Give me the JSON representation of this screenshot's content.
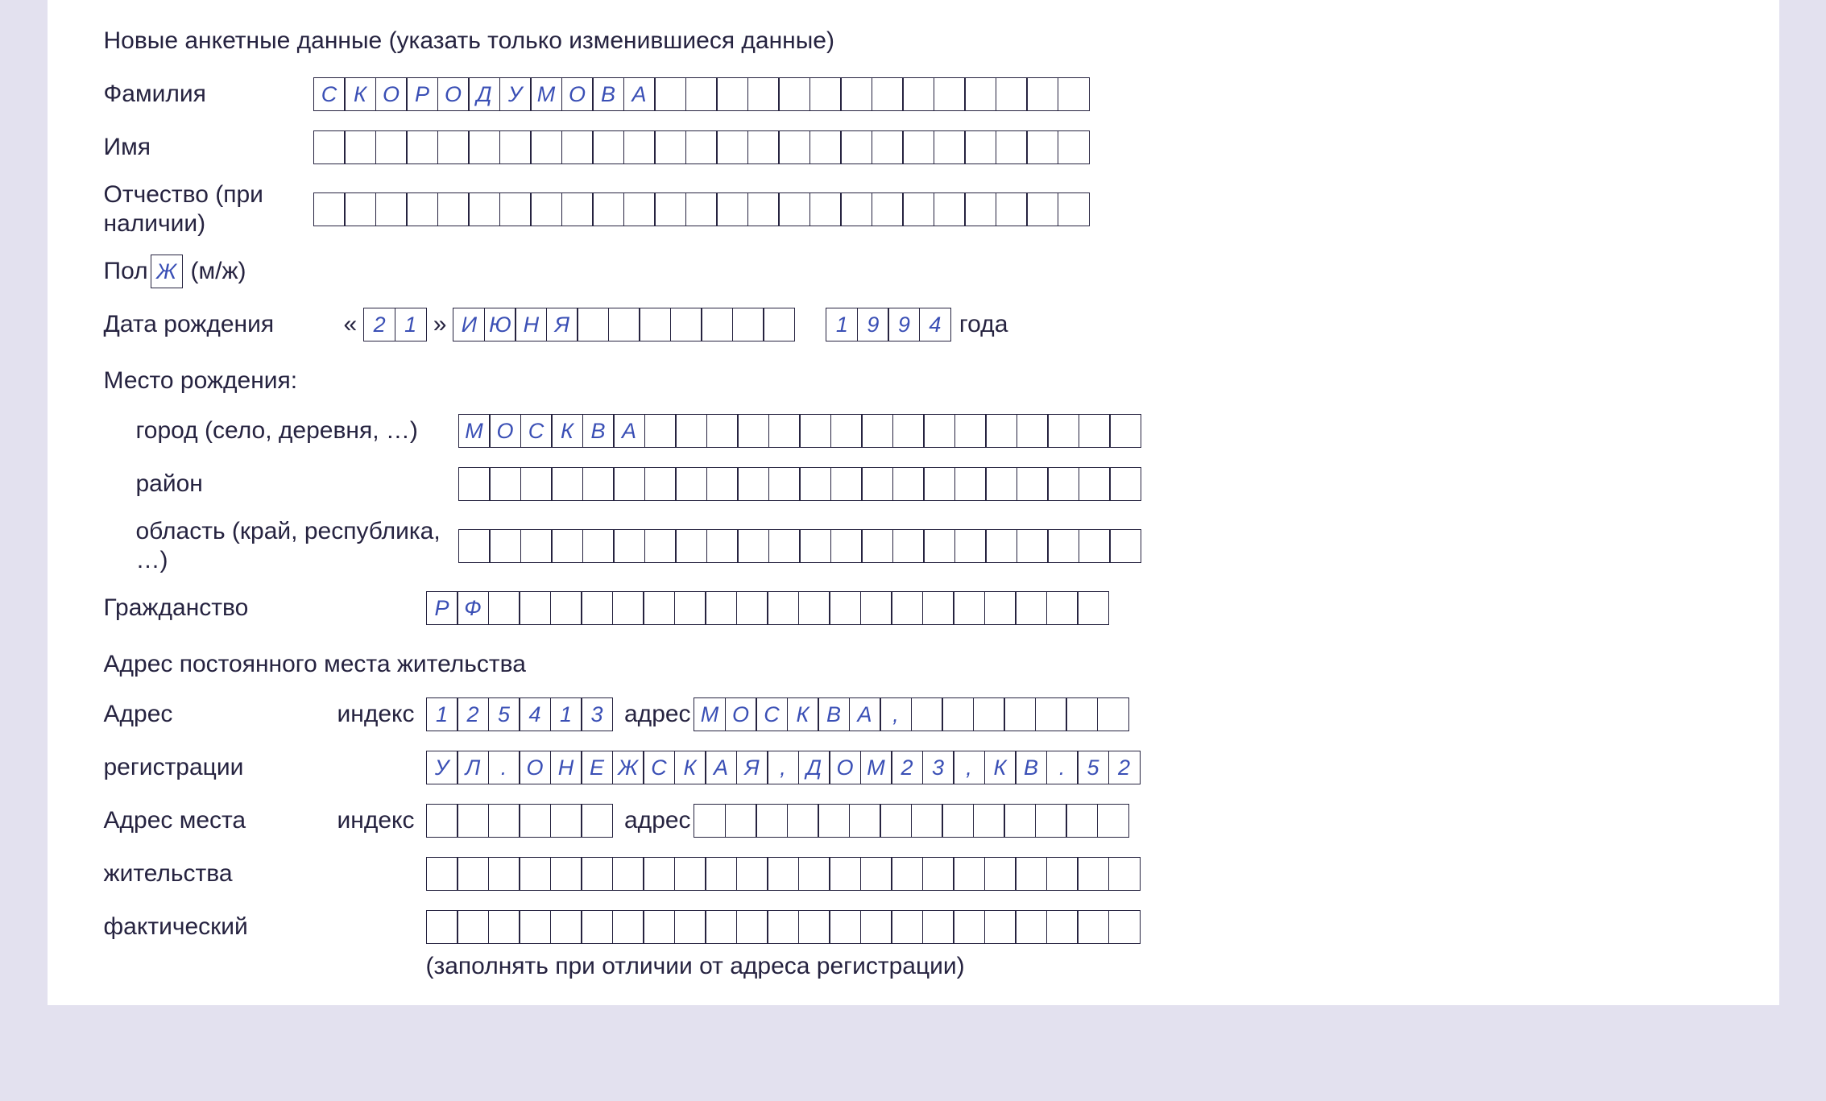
{
  "heading": "Новые анкетные данные (указать только изменившиеся данные)",
  "labels": {
    "surname": "Фамилия",
    "name": "Имя",
    "patronymic": "Отчество (при наличии)",
    "sex_pre": "Пол",
    "sex_post": "(м/ж)",
    "dob": "Дата рождения",
    "year_after": "года",
    "birthplace": "Место рождения:",
    "city": "город (село, деревня, …)",
    "district": "район",
    "region": "область (край, республика, …)",
    "citizenship": "Гражданство",
    "perm_addr": "Адрес постоянного места жительства",
    "addr": "Адрес",
    "registration": "регистрации",
    "addr_fact1": "Адрес места",
    "addr_fact2": "жительства",
    "addr_fact3": "фактический",
    "index": "индекс",
    "addr_word": "адрес",
    "note": "(заполнять при отличии от адреса регистрации)"
  },
  "values": {
    "surname": [
      "С",
      "К",
      "О",
      "Р",
      "О",
      "Д",
      "У",
      "М",
      "О",
      "В",
      "А",
      "",
      "",
      "",
      "",
      "",
      "",
      "",
      "",
      "",
      "",
      "",
      "",
      "",
      ""
    ],
    "name": [
      "",
      "",
      "",
      "",
      "",
      "",
      "",
      "",
      "",
      "",
      "",
      "",
      "",
      "",
      "",
      "",
      "",
      "",
      "",
      "",
      "",
      "",
      "",
      "",
      ""
    ],
    "patr": [
      "",
      "",
      "",
      "",
      "",
      "",
      "",
      "",
      "",
      "",
      "",
      "",
      "",
      "",
      "",
      "",
      "",
      "",
      "",
      "",
      "",
      "",
      "",
      "",
      ""
    ],
    "sex": "Ж",
    "day": [
      "2",
      "1"
    ],
    "month": [
      "И",
      "Ю",
      "Н",
      "Я",
      "",
      "",
      "",
      "",
      "",
      "",
      ""
    ],
    "year": [
      "1",
      "9",
      "9",
      "4"
    ],
    "city": [
      "М",
      "О",
      "С",
      "К",
      "В",
      "А",
      "",
      "",
      "",
      "",
      "",
      "",
      "",
      "",
      "",
      "",
      "",
      "",
      "",
      "",
      "",
      ""
    ],
    "district": [
      "",
      "",
      "",
      "",
      "",
      "",
      "",
      "",
      "",
      "",
      "",
      "",
      "",
      "",
      "",
      "",
      "",
      "",
      "",
      "",
      "",
      ""
    ],
    "region": [
      "",
      "",
      "",
      "",
      "",
      "",
      "",
      "",
      "",
      "",
      "",
      "",
      "",
      "",
      "",
      "",
      "",
      "",
      "",
      "",
      "",
      ""
    ],
    "citizenship": [
      "Р",
      "Ф",
      "",
      "",
      "",
      "",
      "",
      "",
      "",
      "",
      "",
      "",
      "",
      "",
      "",
      "",
      "",
      "",
      "",
      "",
      "",
      ""
    ],
    "reg_index": [
      "1",
      "2",
      "5",
      "4",
      "1",
      "3"
    ],
    "reg_addr1": [
      "М",
      "О",
      "С",
      "К",
      "В",
      "А",
      ",",
      "",
      "",
      "",
      "",
      "",
      "",
      ""
    ],
    "reg_addr2": [
      "У",
      "Л",
      ".",
      "О",
      "Н",
      "Е",
      "Ж",
      "С",
      "К",
      "А",
      "Я",
      ",",
      "Д",
      "О",
      "М",
      "2",
      "3",
      ",",
      "К",
      "В",
      ".",
      "5",
      "2"
    ],
    "fact_index": [
      "",
      "",
      "",
      "",
      "",
      ""
    ],
    "fact_addr1": [
      "",
      "",
      "",
      "",
      "",
      "",
      "",
      "",
      "",
      "",
      "",
      "",
      "",
      ""
    ],
    "fact_addr2": [
      "",
      "",
      "",
      "",
      "",
      "",
      "",
      "",
      "",
      "",
      "",
      "",
      "",
      "",
      "",
      "",
      "",
      "",
      "",
      "",
      "",
      "",
      ""
    ],
    "fact_addr3": [
      "",
      "",
      "",
      "",
      "",
      "",
      "",
      "",
      "",
      "",
      "",
      "",
      "",
      "",
      "",
      "",
      "",
      "",
      "",
      "",
      "",
      "",
      ""
    ]
  }
}
